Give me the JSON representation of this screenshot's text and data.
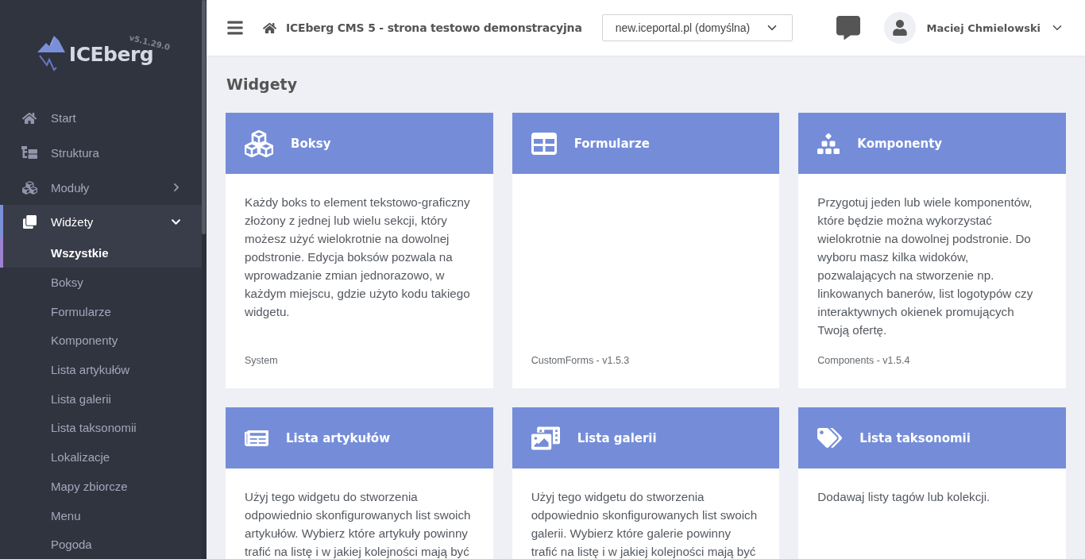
{
  "sidebar": {
    "logo": {
      "name": "ICEberg",
      "version": "v5.1.29.0"
    },
    "items": [
      {
        "label": "Start",
        "kind": "link",
        "selected": false
      },
      {
        "label": "Struktura",
        "kind": "link",
        "selected": false
      },
      {
        "label": "Moduły",
        "kind": "group",
        "selected": false,
        "expanded": false
      },
      {
        "label": "Widżety",
        "kind": "group",
        "selected": true,
        "expanded": true,
        "children": [
          {
            "label": "Wszystkie",
            "selected": true
          },
          {
            "label": "Boksy",
            "selected": false
          },
          {
            "label": "Formularze",
            "selected": false
          },
          {
            "label": "Komponenty",
            "selected": false
          },
          {
            "label": "Lista artykułów",
            "selected": false
          },
          {
            "label": "Lista galerii",
            "selected": false
          },
          {
            "label": "Lista taksonomii",
            "selected": false
          },
          {
            "label": "Lokalizacje",
            "selected": false
          },
          {
            "label": "Mapy zbiorcze",
            "selected": false
          },
          {
            "label": "Menu",
            "selected": false
          },
          {
            "label": "Pogoda",
            "selected": false
          }
        ]
      }
    ]
  },
  "header": {
    "title": "ICEberg CMS 5 - strona testowo demonstracyjna",
    "site_select": {
      "value": "new.iceportal.pl (domyślna)"
    },
    "user": {
      "name": "Maciej Chmielowski"
    }
  },
  "page": {
    "heading": "Widgety",
    "cards": [
      {
        "title": "Boksy",
        "description": "Każdy boks to element tekstowo-graficzny złożony z jednej lub wielu sekcji, który możesz użyć wielokrotnie na dowolnej podstronie. Edycja boksów pozwala na wprowadzanie zmian jednorazowo, w każdym miejscu, gdzie użyto kodu takiego widgetu.",
        "footer": "System"
      },
      {
        "title": "Formularze",
        "footer": "CustomForms - v1.5.3"
      },
      {
        "title": "Komponenty",
        "description": "Przygotuj jeden lub wiele komponentów, które będzie można wykorzystać wielokrotnie na dowolnej podstronie. Do wyboru masz kilka widoków, pozwalających na stworzenie np. linkowanych banerów, list logotypów czy interaktywnych okienek promujących Twoją ofertę.",
        "footer": "Components - v1.5.4"
      },
      {
        "title": "Lista artykułów",
        "description": "Użyj tego widgetu do stworzenia odpowiednio skonfigurowanych list swoich artykułów. Wybierz które artykuły powinny trafić na listę i w jakiej kolejności mają być"
      },
      {
        "title": "Lista galerii",
        "description": "Użyj tego widgetu do stworzenia odpowiednio skonfigurowanych list swoich galerii. Wybierz które galerie powinny trafić na listę i w jakiej kolejności mają być"
      },
      {
        "title": "Lista taksonomii",
        "description": "Dodawaj listy tagów lub kolekcji."
      }
    ]
  }
}
